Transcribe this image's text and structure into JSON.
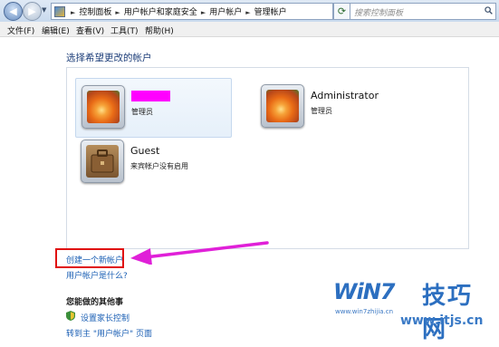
{
  "addressbar": {
    "breadcrumbs": [
      "控制面板",
      "用户帐户和家庭安全",
      "用户帐户",
      "管理帐户"
    ],
    "search_placeholder": "搜索控制面板"
  },
  "menubar": {
    "items": [
      "文件(F)",
      "编辑(E)",
      "查看(V)",
      "工具(T)",
      "帮助(H)"
    ]
  },
  "main": {
    "title": "选择希望更改的帐户",
    "accounts": [
      {
        "name": "",
        "role": "管理员",
        "avatar": "flower-icon",
        "name_redacted": true,
        "selected": true
      },
      {
        "name": "Administrator",
        "role": "管理员",
        "avatar": "flower-icon",
        "selected": false
      },
      {
        "name": "Guest",
        "role": "来宾帐户没有启用",
        "avatar": "guest-briefcase-icon",
        "selected": false
      }
    ],
    "create_account_link": "创建一个新帐户",
    "what_is_account_link": "用户帐户是什么?",
    "other_section_title": "您能做的其他事",
    "parental_control_link": "设置家长控制",
    "goto_main_link": "转到主 \"用户帐户\" 页面"
  },
  "watermark": {
    "brand": "WiN7",
    "brand_cn": "技巧网",
    "url_small": "www.win7zhijia.cn",
    "url_large": "www.itjs.cn"
  },
  "colors": {
    "highlight_box": "#e01010",
    "arrow": "#e020d8",
    "link": "#1b5fb4",
    "redaction": "#ff00ff"
  }
}
